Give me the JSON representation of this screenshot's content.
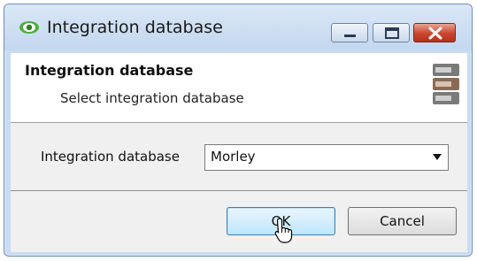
{
  "window": {
    "title": "Integration database"
  },
  "header": {
    "title": "Integration database",
    "subtitle": "Select integration database"
  },
  "form": {
    "label": "Integration database",
    "selected_value": "Morley"
  },
  "buttons": {
    "ok": "OK",
    "cancel": "Cancel"
  },
  "icons": {
    "app": "eye-icon",
    "header": "database-server-icon",
    "minimize": "minimize-icon",
    "maximize": "maximize-icon",
    "close": "close-icon",
    "dropdown": "chevron-down-icon",
    "cursor": "hand-cursor-icon"
  },
  "colors": {
    "titlebar": "#c9dcf2",
    "close_button": "#c9452e",
    "ok_button": "#bee6fd"
  }
}
